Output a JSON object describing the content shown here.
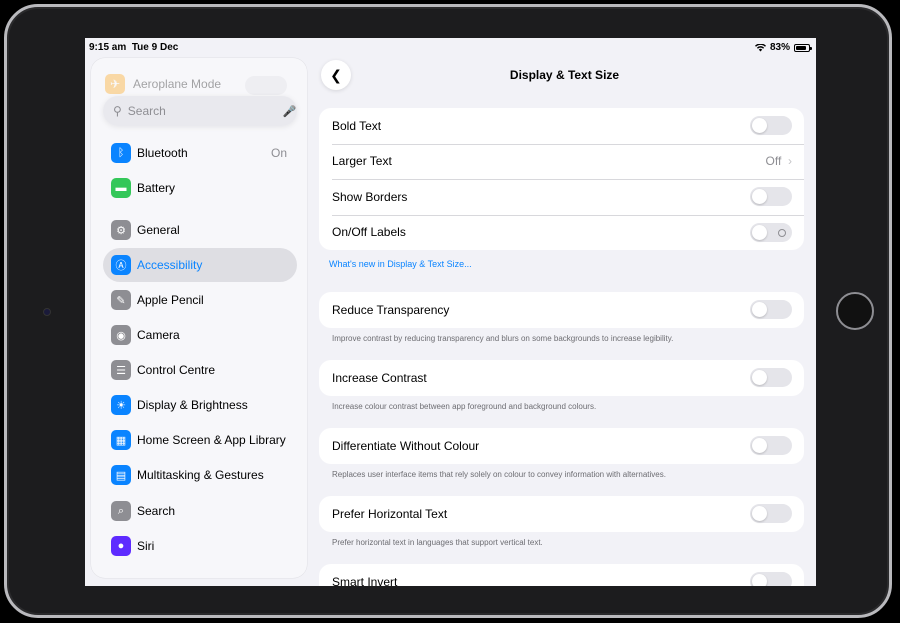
{
  "status": {
    "time": "9:15 am",
    "date": "Tue 9 Dec",
    "battery": "83%",
    "battery_level": 0.83,
    "wifi_icon": "wifi-icon"
  },
  "sidebar": {
    "faded_item": {
      "label": "Aeroplane Mode",
      "icon": "airplane-icon"
    },
    "search_placeholder": "Search",
    "items": [
      {
        "label": "Bluetooth",
        "value": "On",
        "icon": "bluetooth-icon",
        "color": "#0a84ff"
      },
      {
        "label": "Battery",
        "icon": "battery-icon",
        "color": "#34c759"
      },
      {
        "label": "General",
        "icon": "gear-icon",
        "color": "#8e8e93"
      },
      {
        "label": "Accessibility",
        "icon": "accessibility-icon",
        "color": "#0a84ff",
        "selected": true
      },
      {
        "label": "Apple Pencil",
        "icon": "pencil-icon",
        "color": "#8e8e93"
      },
      {
        "label": "Camera",
        "icon": "camera-icon",
        "color": "#8e8e93"
      },
      {
        "label": "Control Centre",
        "icon": "control-centre-icon",
        "color": "#8e8e93"
      },
      {
        "label": "Display & Brightness",
        "icon": "sun-icon",
        "color": "#0a84ff"
      },
      {
        "label": "Home Screen & App Library",
        "icon": "home-screen-icon",
        "color": "#0a84ff"
      },
      {
        "label": "Multitasking & Gestures",
        "icon": "multitasking-icon",
        "color": "#0a84ff"
      },
      {
        "label": "Search",
        "icon": "search-icon",
        "color": "#8e8e93"
      },
      {
        "label": "Siri",
        "icon": "siri-icon",
        "color": "#5e2bff"
      }
    ]
  },
  "main": {
    "title": "Display & Text Size",
    "group1": {
      "bold_text": "Bold Text",
      "larger_text": "Larger Text",
      "larger_text_value": "Off",
      "show_borders": "Show Borders",
      "onoff_labels": "On/Off Labels"
    },
    "whats_new_link": "What's new in Display & Text Size...",
    "reduce_transparency": "Reduce Transparency",
    "reduce_transparency_note": "Improve contrast by reducing transparency and blurs on some backgrounds to increase legibility.",
    "increase_contrast": "Increase Contrast",
    "increase_contrast_note": "Increase colour contrast between app foreground and background colours.",
    "differentiate": "Differentiate Without Colour",
    "differentiate_note": "Replaces user interface items that rely solely on colour to convey information with alternatives.",
    "prefer_horizontal": "Prefer Horizontal Text",
    "prefer_horizontal_note": "Prefer horizontal text in languages that support vertical text.",
    "smart_invert": "Smart Invert"
  }
}
